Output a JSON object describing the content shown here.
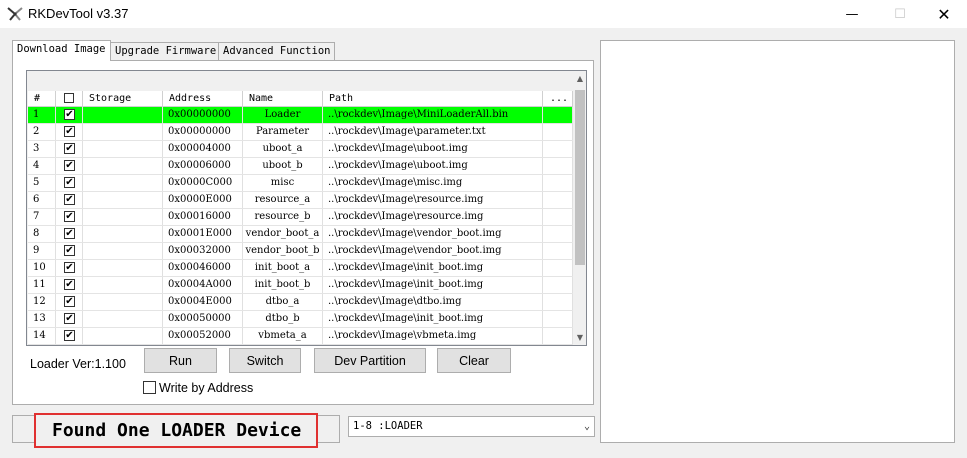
{
  "window": {
    "title": "RKDevTool v3.37",
    "min_icon": "minimize-icon",
    "max_icon": "maximize-icon",
    "close_icon": "close-icon"
  },
  "tabs": [
    {
      "label": "Download Image",
      "active": true
    },
    {
      "label": "Upgrade Firmware",
      "active": false
    },
    {
      "label": "Advanced Function",
      "active": false
    }
  ],
  "table": {
    "columns": [
      "#",
      "",
      "Storage",
      "Address",
      "Name",
      "Path",
      "..."
    ],
    "rows": [
      {
        "num": "1",
        "checked": true,
        "storage": "",
        "address": "0x00000000",
        "name": "Loader",
        "path": "..\\rockdev\\Image\\MiniLoaderAll.bin",
        "selected": true
      },
      {
        "num": "2",
        "checked": true,
        "storage": "",
        "address": "0x00000000",
        "name": "Parameter",
        "path": "..\\rockdev\\Image\\parameter.txt",
        "selected": false
      },
      {
        "num": "3",
        "checked": true,
        "storage": "",
        "address": "0x00004000",
        "name": "uboot_a",
        "path": "..\\rockdev\\Image\\uboot.img",
        "selected": false
      },
      {
        "num": "4",
        "checked": true,
        "storage": "",
        "address": "0x00006000",
        "name": "uboot_b",
        "path": "..\\rockdev\\Image\\uboot.img",
        "selected": false
      },
      {
        "num": "5",
        "checked": true,
        "storage": "",
        "address": "0x0000C000",
        "name": "misc",
        "path": "..\\rockdev\\Image\\misc.img",
        "selected": false
      },
      {
        "num": "6",
        "checked": true,
        "storage": "",
        "address": "0x0000E000",
        "name": "resource_a",
        "path": "..\\rockdev\\Image\\resource.img",
        "selected": false
      },
      {
        "num": "7",
        "checked": true,
        "storage": "",
        "address": "0x00016000",
        "name": "resource_b",
        "path": "..\\rockdev\\Image\\resource.img",
        "selected": false
      },
      {
        "num": "8",
        "checked": true,
        "storage": "",
        "address": "0x0001E000",
        "name": "vendor_boot_a",
        "path": "..\\rockdev\\Image\\vendor_boot.img",
        "selected": false
      },
      {
        "num": "9",
        "checked": true,
        "storage": "",
        "address": "0x00032000",
        "name": "vendor_boot_b",
        "path": "..\\rockdev\\Image\\vendor_boot.img",
        "selected": false
      },
      {
        "num": "10",
        "checked": true,
        "storage": "",
        "address": "0x00046000",
        "name": "init_boot_a",
        "path": "..\\rockdev\\Image\\init_boot.img",
        "selected": false
      },
      {
        "num": "11",
        "checked": true,
        "storage": "",
        "address": "0x0004A000",
        "name": "init_boot_b",
        "path": "..\\rockdev\\Image\\init_boot.img",
        "selected": false
      },
      {
        "num": "12",
        "checked": true,
        "storage": "",
        "address": "0x0004E000",
        "name": "dtbo_a",
        "path": "..\\rockdev\\Image\\dtbo.img",
        "selected": false
      },
      {
        "num": "13",
        "checked": true,
        "storage": "",
        "address": "0x00050000",
        "name": "dtbo_b",
        "path": "..\\rockdev\\Image\\init_boot.img",
        "selected": false
      },
      {
        "num": "14",
        "checked": true,
        "storage": "",
        "address": "0x00052000",
        "name": "vbmeta_a",
        "path": "..\\rockdev\\Image\\vbmeta.img",
        "selected": false
      }
    ]
  },
  "loader_ver": "Loader Ver:1.100",
  "buttons": {
    "run": "Run",
    "switch": "Switch",
    "dev_partition": "Dev Partition",
    "clear": "Clear"
  },
  "write_by_address": {
    "label": "Write by Address",
    "checked": false
  },
  "status": {
    "text": "Found One LOADER Device"
  },
  "device_select": {
    "value": "1-8 :LOADER"
  },
  "colors": {
    "selected_row": "#00ff00",
    "highlight_border": "#e03030"
  }
}
